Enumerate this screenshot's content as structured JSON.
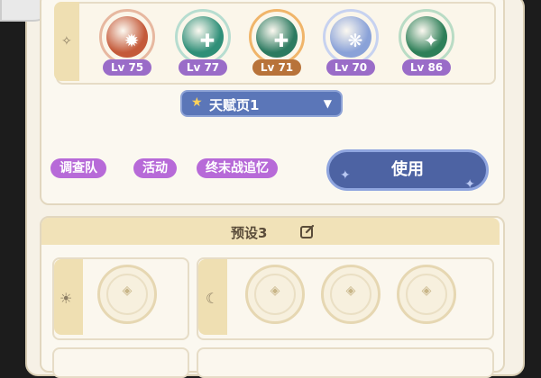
{
  "characters": [
    {
      "level": "Lv 75",
      "glyph": "✹",
      "core": "#c45a3a",
      "ring": "#e7b8a0"
    },
    {
      "level": "Lv 77",
      "glyph": "✚",
      "core": "#2f8f78",
      "ring": "#b7ddd0"
    },
    {
      "level": "Lv 71",
      "glyph": "✚",
      "core": "#2c7a60",
      "ring": "#f0b56a"
    },
    {
      "level": "Lv 70",
      "glyph": "❋",
      "core": "#8aa2d8",
      "ring": "#c7d2f0"
    },
    {
      "level": "Lv 86",
      "glyph": "✦",
      "core": "#2e7f58",
      "ring": "#b9dcc5"
    }
  ],
  "talent_page": {
    "label": "天赋页1"
  },
  "tags": [
    "调查队",
    "活动",
    "终末战追忆"
  ],
  "use_button": "使用",
  "preset": {
    "title": "预设3"
  },
  "colors": {
    "accent_blue": "#4d63a3",
    "tag_purple": "#b76ad8",
    "level_badge": "#9a6cc8"
  }
}
